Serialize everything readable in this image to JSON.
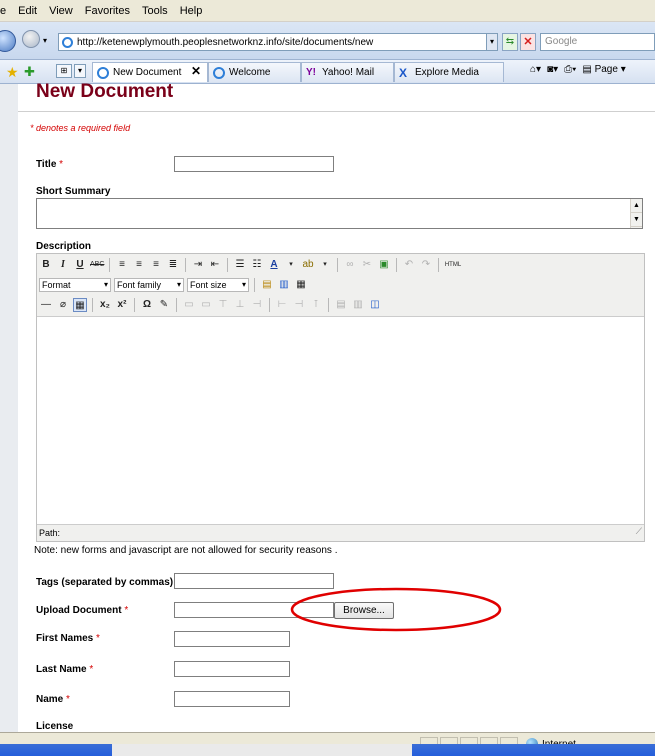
{
  "menu": [
    "e",
    "Edit",
    "View",
    "Favorites",
    "Tools",
    "Help"
  ],
  "address": {
    "url": "http://ketenewplymouth.peoplesnetworknz.info/site/documents/new",
    "search_placeholder": "Google"
  },
  "tabs": [
    {
      "label": "New Document",
      "active": true,
      "icon": "ie-page-icon"
    },
    {
      "label": "Welcome",
      "active": false,
      "icon": "ie-page-icon"
    },
    {
      "label": "Yahoo! Mail",
      "active": false,
      "icon": "yahoo-icon"
    },
    {
      "label": "Explore Media",
      "active": false,
      "icon": "x-icon"
    }
  ],
  "command_bar": {
    "page_label": "Page"
  },
  "form": {
    "title": "New Document",
    "required_note": "* denotes a required field",
    "fields": {
      "title": "Title",
      "short_summary": "Short Summary",
      "description": "Description",
      "tags": "Tags (separated by commas)",
      "upload": "Upload Document",
      "first_names": "First Names",
      "last_name": "Last Name",
      "name": "Name",
      "license": "License"
    },
    "required_mark": "*",
    "browse_label": "Browse...",
    "security_note": "Note: new forms and javascript are not allowed for security reasons ."
  },
  "editor": {
    "format_label": "Format",
    "font_family_label": "Font family",
    "font_size_label": "Font size",
    "path_label": "Path:",
    "html_label": "HTML"
  },
  "status": {
    "zone": "Internet"
  },
  "colors": {
    "title": "#7a0019",
    "required": "#d40000",
    "highlight": "#e00000"
  }
}
